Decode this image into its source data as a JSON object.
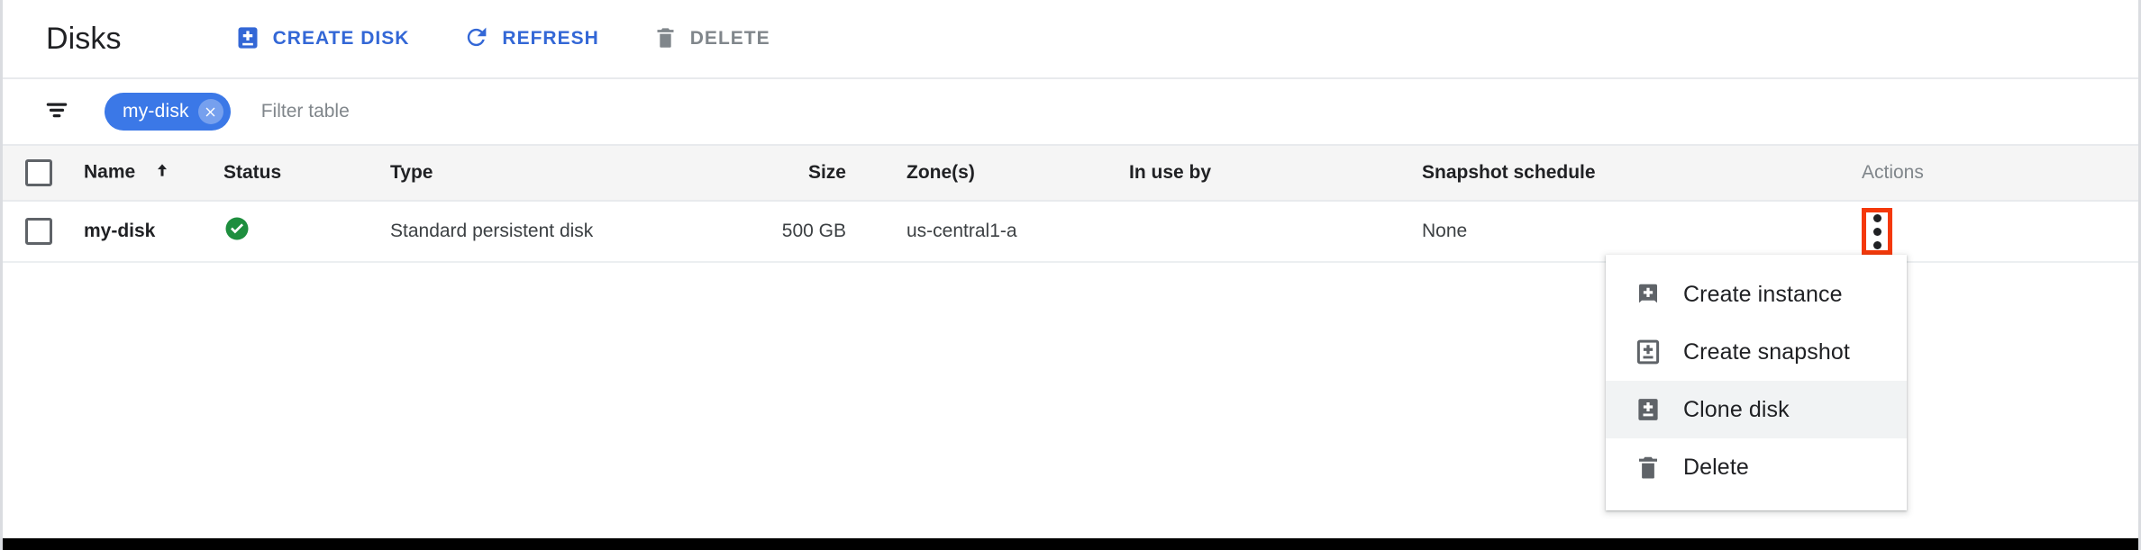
{
  "header": {
    "title": "Disks",
    "actions": [
      {
        "label": "CREATE DISK",
        "icon": "disk-add-icon",
        "state": "enabled",
        "color": "#3367d6"
      },
      {
        "label": "REFRESH",
        "icon": "refresh-icon",
        "state": "enabled",
        "color": "#3367d6"
      },
      {
        "label": "DELETE",
        "icon": "trash-icon",
        "state": "disabled",
        "color": "#80868b"
      }
    ]
  },
  "filter": {
    "icon": "filter-list-icon",
    "chips": [
      {
        "label": "my-disk",
        "remove_icon": "close-icon",
        "color": "#3b78e7"
      }
    ],
    "placeholder": "Filter table",
    "value": ""
  },
  "table": {
    "select_all_checkbox": false,
    "columns": [
      {
        "key": "checkbox",
        "label": ""
      },
      {
        "key": "name",
        "label": "Name",
        "sort": "asc",
        "sort_icon": "arrow-up-icon"
      },
      {
        "key": "status",
        "label": "Status"
      },
      {
        "key": "type",
        "label": "Type"
      },
      {
        "key": "size",
        "label": "Size"
      },
      {
        "key": "zone",
        "label": "Zone(s)"
      },
      {
        "key": "in_use_by",
        "label": "In use by"
      },
      {
        "key": "snapshot_schedule",
        "label": "Snapshot schedule"
      },
      {
        "key": "actions",
        "label": "Actions"
      }
    ],
    "rows": [
      {
        "checked": false,
        "name": "my-disk",
        "status_icon": "check-circle-icon",
        "status_color": "#1e8e3e",
        "type": "Standard persistent disk",
        "size": "500 GB",
        "zone": "us-central1-a",
        "in_use_by": "",
        "snapshot_schedule": "None",
        "actions_icon": "more-vert-icon"
      }
    ]
  },
  "context_menu": {
    "open": true,
    "highlight_color": "#f4380a",
    "items": [
      {
        "label": "Create instance",
        "icon": "instance-add-icon",
        "active": false
      },
      {
        "label": "Create snapshot",
        "icon": "snapshot-add-icon",
        "active": false
      },
      {
        "label": "Clone disk",
        "icon": "disk-clone-icon",
        "active": true
      },
      {
        "label": "Delete",
        "icon": "trash-icon",
        "active": false
      }
    ]
  }
}
